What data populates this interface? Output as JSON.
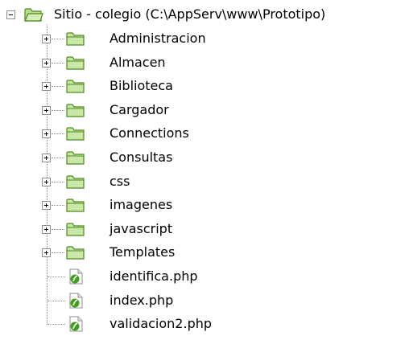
{
  "root": {
    "label": "Sitio - colegio (C:\\AppServ\\www\\Prototipo)",
    "icon": "open-folder-icon",
    "expanded": true
  },
  "folders": [
    {
      "label": "Administracion",
      "icon": "folder-icon",
      "expanded": false
    },
    {
      "label": "Almacen",
      "icon": "folder-icon",
      "expanded": false
    },
    {
      "label": "Biblioteca",
      "icon": "folder-icon",
      "expanded": false
    },
    {
      "label": "Cargador",
      "icon": "folder-icon",
      "expanded": false
    },
    {
      "label": "Connections",
      "icon": "folder-icon",
      "expanded": false
    },
    {
      "label": "Consultas",
      "icon": "folder-icon",
      "expanded": false
    },
    {
      "label": "css",
      "icon": "folder-icon",
      "expanded": false
    },
    {
      "label": "imagenes",
      "icon": "folder-icon",
      "expanded": false
    },
    {
      "label": "javascript",
      "icon": "folder-icon",
      "expanded": false
    },
    {
      "label": "Templates",
      "icon": "folder-icon",
      "expanded": false
    }
  ],
  "files": [
    {
      "label": "identifica.php",
      "icon": "php-file-icon"
    },
    {
      "label": "index.php",
      "icon": "php-file-icon"
    },
    {
      "label": "validacion2.php",
      "icon": "php-file-icon"
    }
  ],
  "colors": {
    "folder_fill": "#c9e7a6",
    "folder_stroke": "#4d8a1f",
    "php_green": "#3f9f1c",
    "connector": "#8a8a8a"
  }
}
